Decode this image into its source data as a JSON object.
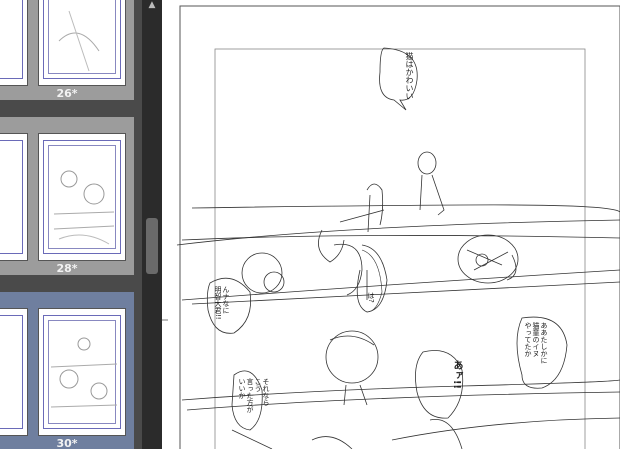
{
  "pages": {
    "p26": {
      "label": "26*"
    },
    "p28": {
      "label": "28*"
    },
    "p30": {
      "label": "30*"
    }
  },
  "canvas": {
    "bubbles": {
      "cat": "猫はかわいい",
      "huh": "は?",
      "surprise": "んナなに\n明智大君!!",
      "teacher": "ああたしかに\n猫童のイヌ\nやってたか",
      "ah": "あァ!!",
      "other": "それなら\nこう\n言った方が\nいいか"
    }
  }
}
